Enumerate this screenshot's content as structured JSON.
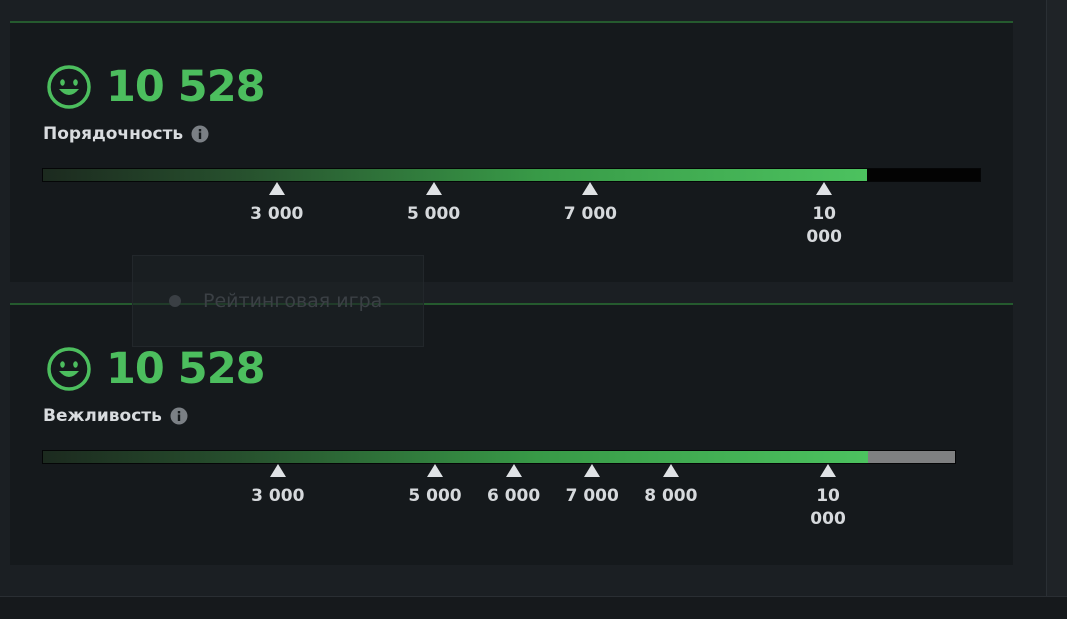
{
  "colors": {
    "accent": "#4cbe5e",
    "panel": "#15191c",
    "divider": "#255a2e"
  },
  "panels": [
    {
      "score": "10 528",
      "label": "Порядочность",
      "progress_fraction": 0.877,
      "rest_color": "#030303",
      "markers": [
        {
          "label": "3 000",
          "pos": 0.25
        },
        {
          "label": "5 000",
          "pos": 0.417
        },
        {
          "label": "7 000",
          "pos": 0.584
        },
        {
          "label": "10 000",
          "pos": 0.833,
          "wrap": true
        }
      ]
    },
    {
      "score": "10 528",
      "label": "Вежливость",
      "progress_fraction": 0.903,
      "rest_color": "#7f8081",
      "markers": [
        {
          "label": "3 000",
          "pos": 0.258
        },
        {
          "label": "5 000",
          "pos": 0.43
        },
        {
          "label": "6 000",
          "pos": 0.516
        },
        {
          "label": "7 000",
          "pos": 0.602
        },
        {
          "label": "8 000",
          "pos": 0.688
        },
        {
          "label": "10 000",
          "pos": 0.86,
          "wrap": true
        }
      ]
    }
  ],
  "overlay": {
    "text": "Рейтинговая игра"
  }
}
